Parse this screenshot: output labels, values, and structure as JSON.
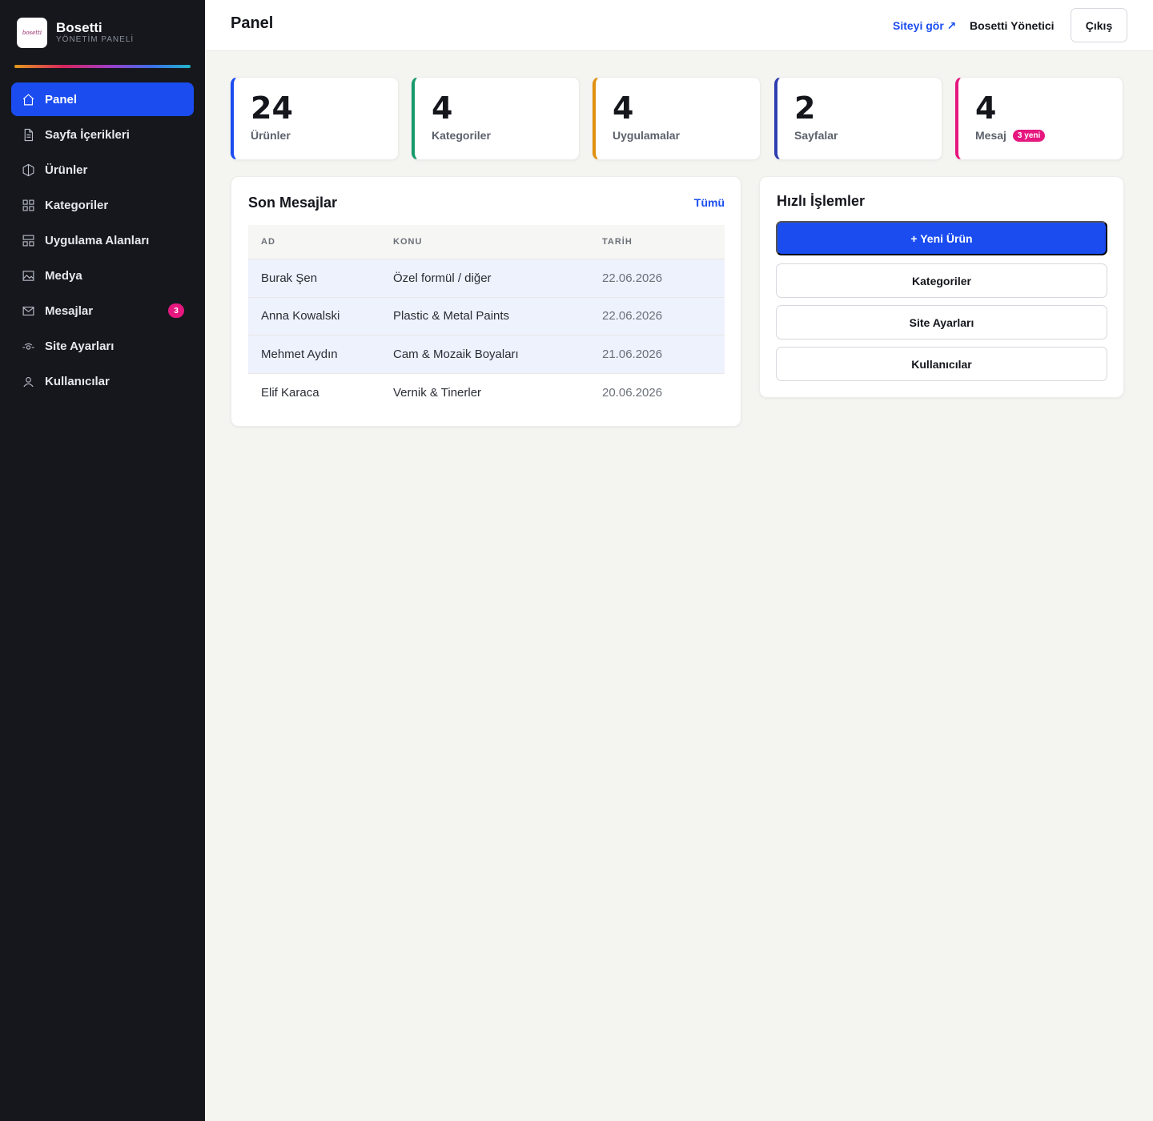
{
  "brand": {
    "logo_text": "bosetti",
    "name": "Bosetti",
    "subtitle": "YÖNETİM PANELİ"
  },
  "sidebar": {
    "items": [
      {
        "label": "Panel",
        "icon": "home-icon",
        "active": true
      },
      {
        "label": "Sayfa İçerikleri",
        "icon": "document-icon"
      },
      {
        "label": "Ürünler",
        "icon": "box-icon"
      },
      {
        "label": "Kategoriler",
        "icon": "grid-icon"
      },
      {
        "label": "Uygulama Alanları",
        "icon": "layout-icon"
      },
      {
        "label": "Medya",
        "icon": "image-icon"
      },
      {
        "label": "Mesajlar",
        "icon": "mail-icon",
        "badge": "3"
      },
      {
        "label": "Site Ayarları",
        "icon": "settings-icon"
      },
      {
        "label": "Kullanıcılar",
        "icon": "user-icon"
      }
    ]
  },
  "header": {
    "title": "Panel",
    "site_link": "Siteyi gör ↗",
    "admin_name": "Bosetti Yönetici",
    "logout": "Çıkış"
  },
  "stats": [
    {
      "value": "24",
      "label": "Ürünler",
      "color": "#1a4cf0"
    },
    {
      "value": "4",
      "label": "Kategoriler",
      "color": "#169a6a"
    },
    {
      "value": "4",
      "label": "Uygulamalar",
      "color": "#e0900e"
    },
    {
      "value": "2",
      "label": "Sayfalar",
      "color": "#2f3fb0"
    },
    {
      "value": "4",
      "label": "Mesaj",
      "badge": "3 yeni",
      "color": "#e6177f"
    }
  ],
  "messages": {
    "title": "Son Mesajlar",
    "all_link": "Tümü",
    "columns": [
      "AD",
      "KONU",
      "TARİH"
    ],
    "rows": [
      {
        "name": "Burak Şen",
        "subject": "Özel formül / diğer",
        "date": "22.06.2026",
        "unread": true
      },
      {
        "name": "Anna Kowalski",
        "subject": "Plastic & Metal Paints",
        "date": "22.06.2026",
        "unread": true
      },
      {
        "name": "Mehmet Aydın",
        "subject": "Cam & Mozaik Boyaları",
        "date": "21.06.2026",
        "unread": true
      },
      {
        "name": "Elif Karaca",
        "subject": "Vernik & Tinerler",
        "date": "20.06.2026",
        "unread": false
      }
    ]
  },
  "quick_actions": {
    "title": "Hızlı İşlemler",
    "buttons": [
      "+ Yeni Ürün",
      "Kategoriler",
      "Site Ayarları",
      "Kullanıcılar"
    ]
  }
}
